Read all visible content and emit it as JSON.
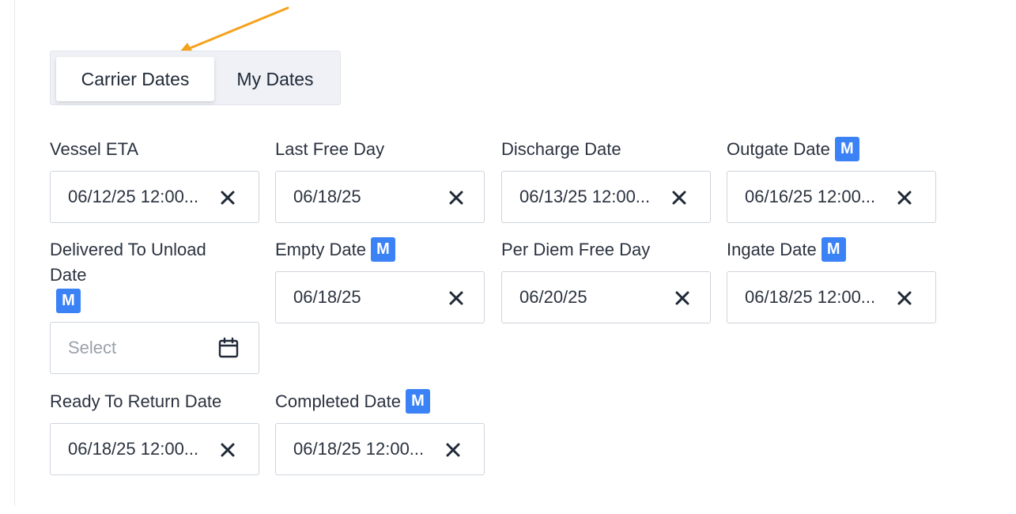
{
  "tabs": [
    {
      "label": "Carrier Dates",
      "active": true
    },
    {
      "label": "My Dates",
      "active": false
    }
  ],
  "manual_badge": "M",
  "annotation": {
    "icon": "arrow-pointer",
    "color": "#f59e0b"
  },
  "accent_color": "#3b82f6",
  "fields": {
    "vessel_eta": {
      "label": "Vessel ETA",
      "value": "06/12/25 12:00..."
    },
    "last_free_day": {
      "label": "Last Free Day",
      "value": "06/18/25"
    },
    "discharge_date": {
      "label": "Discharge Date",
      "value": "06/13/25 12:00..."
    },
    "outgate_date": {
      "label": "Outgate Date",
      "value": "06/16/25 12:00..."
    },
    "delivered_to_unload_date": {
      "label": "Delivered To Unload Date",
      "value": "",
      "placeholder": "Select"
    },
    "empty_date": {
      "label": "Empty Date",
      "value": "06/18/25"
    },
    "per_diem_free_day": {
      "label": "Per Diem Free Day",
      "value": "06/20/25"
    },
    "ingate_date": {
      "label": "Ingate Date",
      "value": "06/18/25 12:00..."
    },
    "ready_to_return_date": {
      "label": "Ready To Return Date",
      "value": "06/18/25 12:00..."
    },
    "completed_date": {
      "label": "Completed Date",
      "value": "06/18/25 12:00..."
    }
  }
}
